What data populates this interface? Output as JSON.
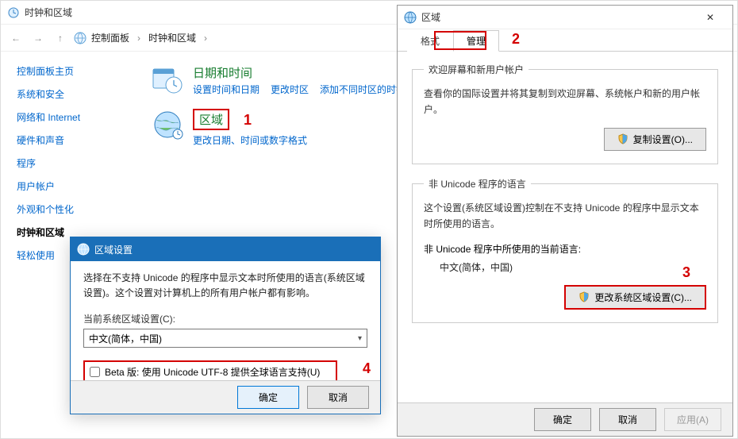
{
  "cp": {
    "title": "时钟和区域",
    "crumb1": "控制面板",
    "crumb2": "时钟和区域",
    "sidebar": {
      "home": "控制面板主页",
      "items": [
        "系统和安全",
        "网络和 Internet",
        "硬件和声音",
        "程序",
        "用户帐户",
        "外观和个性化",
        "时钟和区域",
        "轻松使用"
      ],
      "active_index": 6
    },
    "date_time": {
      "heading": "日期和时间",
      "links": [
        "设置时间和日期",
        "更改时区",
        "添加不同时区的时钟"
      ]
    },
    "region": {
      "heading": "区域",
      "link": "更改日期、时间或数字格式"
    }
  },
  "annotations": {
    "n1": "1",
    "n2": "2",
    "n3": "3",
    "n4": "4"
  },
  "region_dlg": {
    "title": "区域",
    "tabs": {
      "format": "格式",
      "admin": "管理"
    },
    "welcome": {
      "legend": "欢迎屏幕和新用户帐户",
      "text": "查看你的国际设置并将其复制到欢迎屏幕、系统帐户和新的用户帐户。",
      "button": "复制设置(O)..."
    },
    "nonunicode": {
      "legend": "非 Unicode 程序的语言",
      "text": "这个设置(系统区域设置)控制在不支持 Unicode 的程序中显示文本时所使用的语言。",
      "cur_label": "非 Unicode 程序中所使用的当前语言:",
      "cur_value": "中文(简体，中国)",
      "button": "更改系统区域设置(C)..."
    },
    "footer": {
      "ok": "确定",
      "cancel": "取消",
      "apply": "应用(A)"
    }
  },
  "sub_dlg": {
    "title": "区域设置",
    "desc": "选择在不支持 Unicode 的程序中显示文本时所使用的语言(系统区域设置)。这个设置对计算机上的所有用户帐户都有影响。",
    "combo_label": "当前系统区域设置(C):",
    "combo_value": "中文(简体，中国)",
    "utf8_label": "Beta 版: 使用 Unicode UTF-8 提供全球语言支持(U)",
    "ok": "确定",
    "cancel": "取消"
  }
}
